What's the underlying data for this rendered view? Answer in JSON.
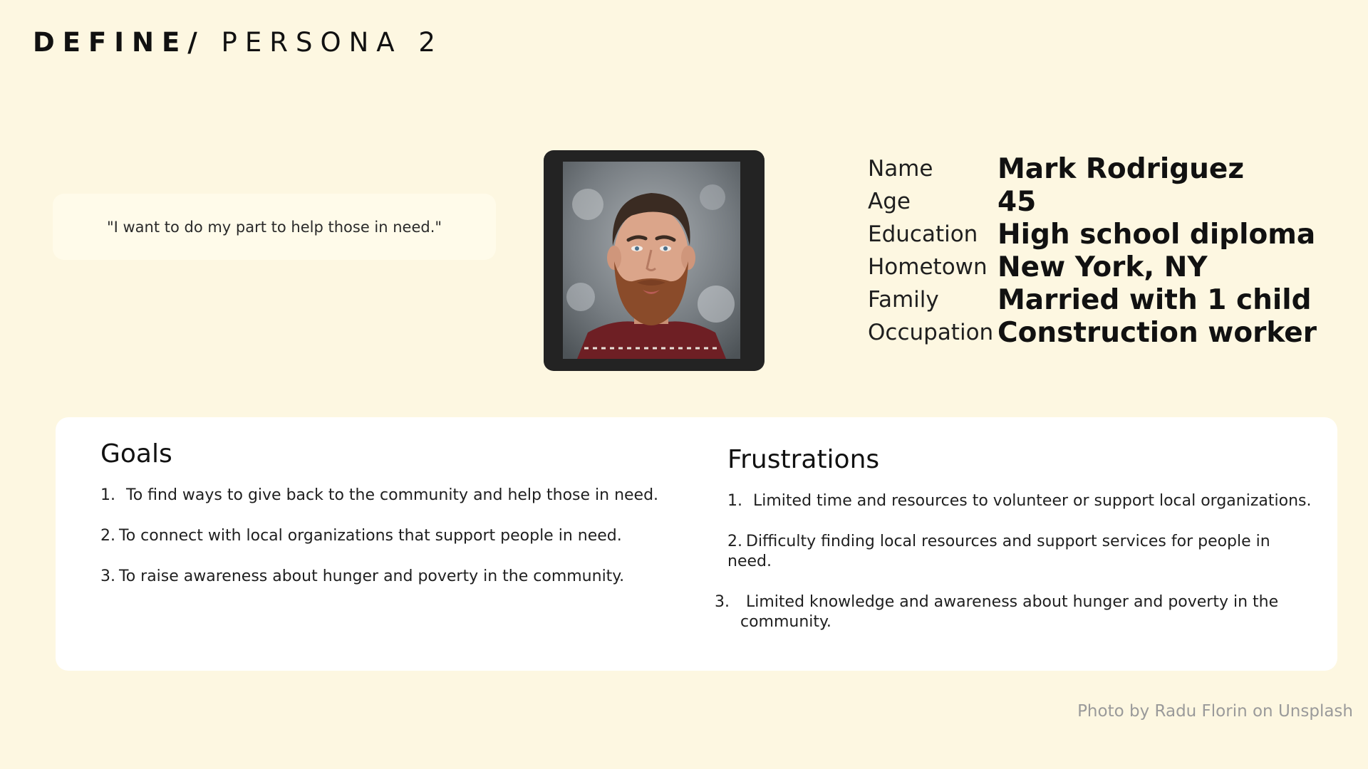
{
  "header": {
    "title_bold": "DEFINE/",
    "title_light": " PERSONA 2"
  },
  "quote": {
    "text": "\"I want to do my part to help those in need.\""
  },
  "profile": {
    "fields": [
      {
        "label": "Name",
        "value": "Mark Rodriguez"
      },
      {
        "label": "Age",
        "value": "45"
      },
      {
        "label": "Education",
        "value": "High school diploma"
      },
      {
        "label": "Hometown",
        "value": "New York, NY"
      },
      {
        "label": "Family",
        "value": "Married with 1 child"
      },
      {
        "label": "Occupation",
        "value": "Construction worker"
      }
    ]
  },
  "goals": {
    "heading": "Goals",
    "items": [
      {
        "number": "1.",
        "text": "To find ways to give back to the community and help those in need."
      },
      {
        "number": "2.",
        "text": "To connect with local organizations that support people in need."
      },
      {
        "number": "3.",
        "text": "To raise awareness about hunger and poverty in the community."
      }
    ]
  },
  "frustrations": {
    "heading": "Frustrations",
    "items": [
      {
        "number": "1.",
        "text": "Limited time and resources to volunteer or support local organizations."
      },
      {
        "number": "2.",
        "text": "Difficulty finding local resources and support services for people in need."
      },
      {
        "number": "3.",
        "text": "Limited knowledge and awareness about hunger and poverty in the community."
      }
    ]
  },
  "credit": {
    "text": "Photo by Radu Florin on Unsplash"
  },
  "colors": {
    "background": "#fdf7e1",
    "card": "#ffffff",
    "quote_card": "#fffbea",
    "photo_frame": "#232323",
    "credit_text": "#9a9a9a"
  }
}
